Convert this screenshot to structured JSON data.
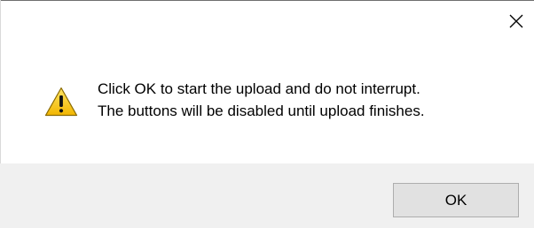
{
  "dialog": {
    "message_line1": "Click OK to start the upload and do not interrupt.",
    "message_line2": "The buttons will be disabled until upload finishes.",
    "ok_label": "OK",
    "close_glyph": "×",
    "icon": "warning-triangle-icon",
    "colors": {
      "footer_bg": "#f0f0f0",
      "button_bg": "#e1e1e1",
      "button_border": "#adadad",
      "icon_yellow": "#f7c600"
    }
  }
}
